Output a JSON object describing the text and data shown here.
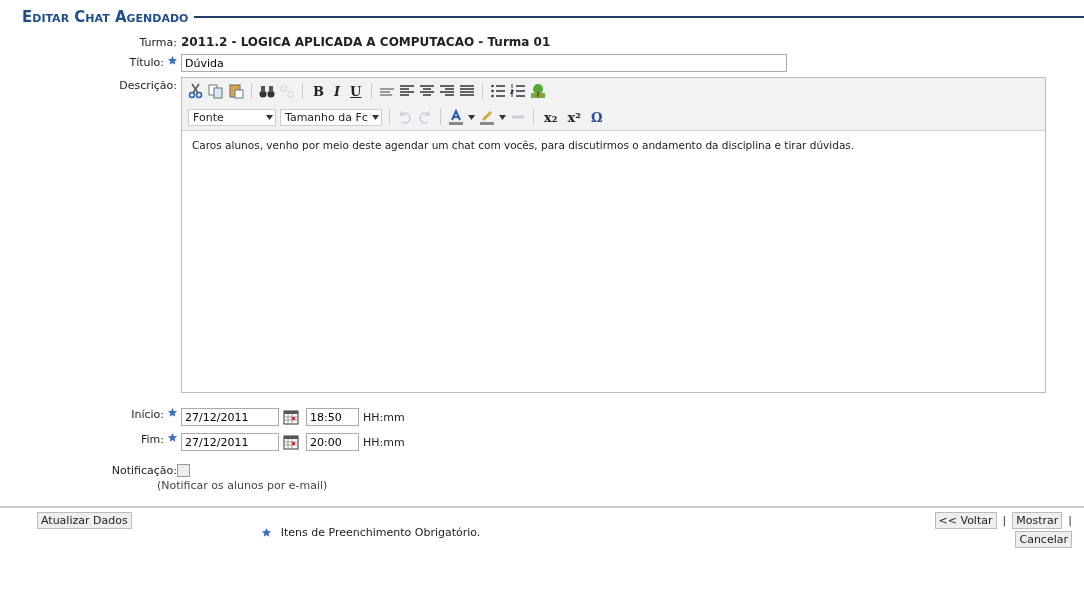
{
  "heading": "Editar Chat Agendado",
  "turma": {
    "label": "Turma:",
    "value": "2011.2 - LOGICA APLICADA A COMPUTACAO - Turma 01"
  },
  "titulo": {
    "label": "Título:",
    "value": "Dúvida",
    "required": true
  },
  "descricao": {
    "label": "Descrição:",
    "toolbar_glyphs": [
      "B",
      "I",
      "U",
      "x₂",
      "x²",
      "Ω"
    ],
    "font_select": "Fonte",
    "size_select": "Tamanho da Fc",
    "text": "Caros alunos, venho por meio deste agendar um chat com vocês, para discutirmos o andamento da disciplina e tirar dúvidas."
  },
  "schedule": [
    {
      "label": "Início:",
      "required": true,
      "date": "27/12/2011",
      "time": "18:50",
      "time_hint": "HH:mm"
    },
    {
      "label": "Fim:",
      "required": true,
      "date": "27/12/2011",
      "time": "20:00",
      "time_hint": "HH:mm"
    }
  ],
  "notificacao": {
    "label": "Notificação:",
    "checked": false,
    "hint": "(Notificar os alunos por e-mail)"
  },
  "footer": {
    "submit": "Atualizar Dados",
    "required_note": "Itens de Preenchimento Obrigatório.",
    "buttons": [
      "<< Voltar",
      "Mostrar",
      "Cancelar"
    ],
    "separator": "|"
  }
}
